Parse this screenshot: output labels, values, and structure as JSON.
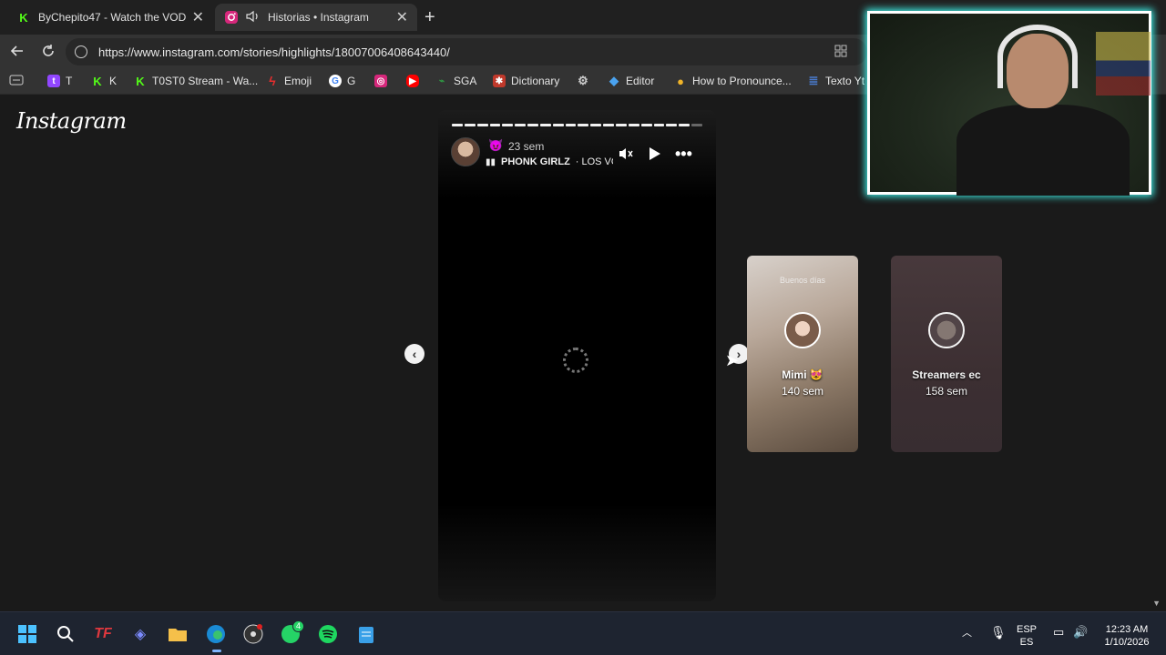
{
  "browser": {
    "tabs": [
      {
        "title": "ByChepito47 - Watch the VOD on",
        "favicon": "K",
        "close": "✕"
      },
      {
        "title": "Historias • Instagram",
        "favicon": "ig",
        "close": "✕"
      }
    ],
    "new_tab": "+",
    "url": "https://www.instagram.com/stories/highlights/18007006408643440/",
    "bookmarks": [
      {
        "label": "T",
        "icon": "twitch-icon",
        "color": "#9146ff"
      },
      {
        "label": "K",
        "icon": "kick-icon",
        "color": "#53fc18"
      },
      {
        "label": "T0ST0 Stream - Wa...",
        "icon": "kick-icon",
        "color": "#53fc18"
      },
      {
        "label": "Emoji",
        "icon": "bolt-icon",
        "color": "#e52e2e"
      },
      {
        "label": "G",
        "icon": "google-icon",
        "color": "#4285f4"
      },
      {
        "label": "",
        "icon": "instagram-icon",
        "color": "#e1306c"
      },
      {
        "label": "",
        "icon": "youtube-icon",
        "color": "#ff0000"
      },
      {
        "label": "SGA",
        "icon": "sga-icon",
        "color": "#2f9e44"
      },
      {
        "label": "Dictionary",
        "icon": "dictionary-icon",
        "color": "#c0392b"
      },
      {
        "label": "",
        "icon": "openai-icon",
        "color": "#cccccc"
      },
      {
        "label": "Editor",
        "icon": "editor-icon",
        "color": "#4aa3f0"
      },
      {
        "label": "How to Pronounce...",
        "icon": "pronounce-icon",
        "color": "#f0b429"
      },
      {
        "label": "Texto Yt",
        "icon": "doc-icon",
        "color": "#4a7bd0"
      }
    ]
  },
  "page": {
    "logo": "Instagram",
    "story": {
      "emoji": "😈",
      "time": "23 sem",
      "audio_artist": "PHONK GIRLZ",
      "audio_sep": "·",
      "audio_title": "LOS VO",
      "progress_segments": 20,
      "progress_viewed": 19
    },
    "highlights": [
      {
        "name": "Mimi 😻",
        "ago": "140 sem",
        "caption": "Buenos días"
      },
      {
        "name": "Streamers ec",
        "ago": "158 sem",
        "caption": ""
      }
    ]
  },
  "taskbar": {
    "lang_top": "ESP",
    "lang_bottom": "ES",
    "time": "12:23 AM",
    "date": "1/10/2026",
    "whatsapp_badge": "4"
  }
}
